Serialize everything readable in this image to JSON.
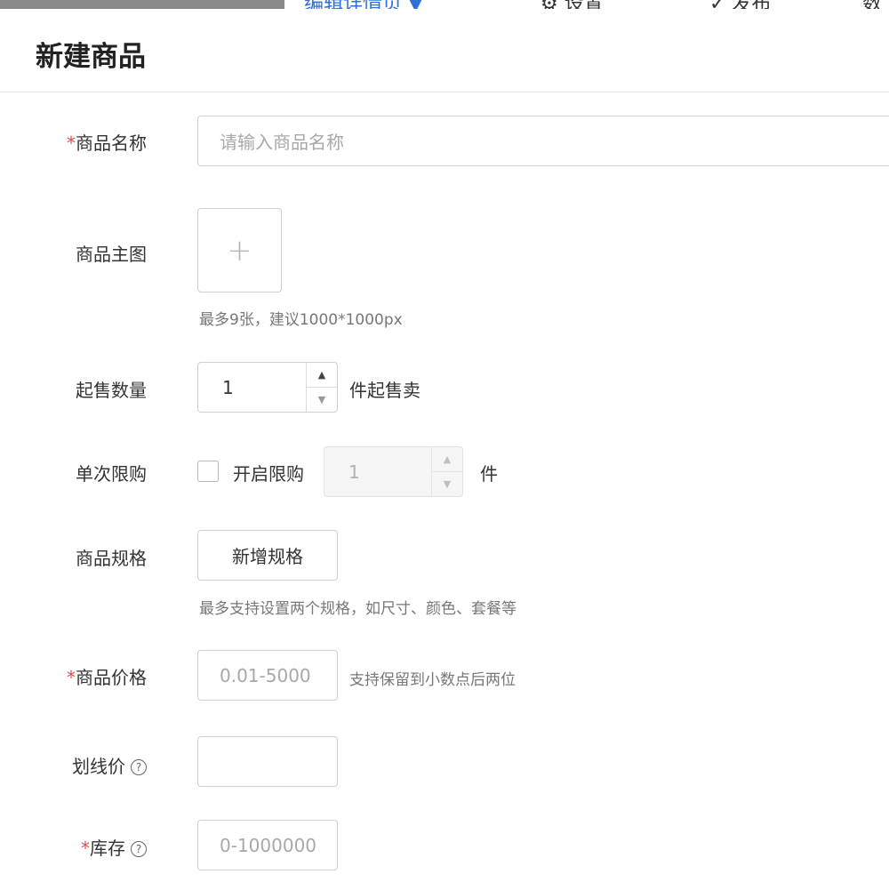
{
  "topbar": {
    "crumbs": [
      {
        "label": "编辑详情页 ▼",
        "active": true
      },
      {
        "label": "⚙ 设置",
        "active": false
      },
      {
        "label": "✓ 发布",
        "active": false
      },
      {
        "label": "数",
        "active": false
      }
    ]
  },
  "header": {
    "title": "新建商品"
  },
  "form": {
    "name": {
      "required_mark": "*",
      "label": "商品名称",
      "placeholder": "请输入商品名称"
    },
    "main_image": {
      "label": "商品主图",
      "upload_symbol": "+",
      "hint": "最多9张，建议1000*1000px"
    },
    "min_qty": {
      "label": "起售数量",
      "value": "1",
      "suffix": "件起售卖"
    },
    "limit": {
      "label": "单次限购",
      "checkbox_label": "开启限购",
      "value": "1",
      "suffix": "件",
      "checked": false
    },
    "spec": {
      "label": "商品规格",
      "button": "新增规格",
      "hint": "最多支持设置两个规格，如尺寸、颜色、套餐等"
    },
    "price": {
      "required_mark": "*",
      "label": "商品价格",
      "placeholder": "0.01-5000",
      "hint": "支持保留到小数点后两位"
    },
    "strike_price": {
      "label": "划线价",
      "help": "?"
    },
    "stock": {
      "required_mark": "*",
      "label": "库存",
      "help": "?",
      "placeholder": "0-1000000"
    }
  }
}
